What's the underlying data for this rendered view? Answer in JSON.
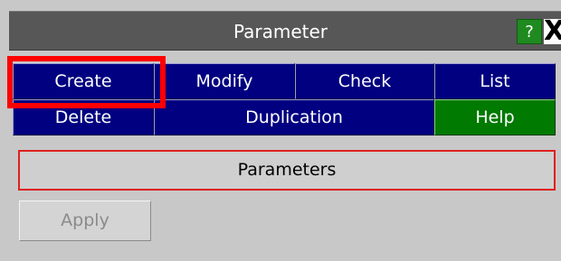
{
  "window": {
    "title": "Parameter",
    "help_label": "?",
    "close_label": "X"
  },
  "toolbar": {
    "row1": [
      "Create",
      "Modify",
      "Check",
      "List"
    ],
    "row2": [
      "Delete",
      "Duplication",
      "Help"
    ]
  },
  "panel": {
    "parameters_label": "Parameters",
    "apply_label": "Apply"
  },
  "colors": {
    "button_blue": "#000080",
    "button_green": "#007a00",
    "highlight_red": "#ff0000",
    "title_bar": "#575757",
    "background": "#c8c8c8"
  }
}
